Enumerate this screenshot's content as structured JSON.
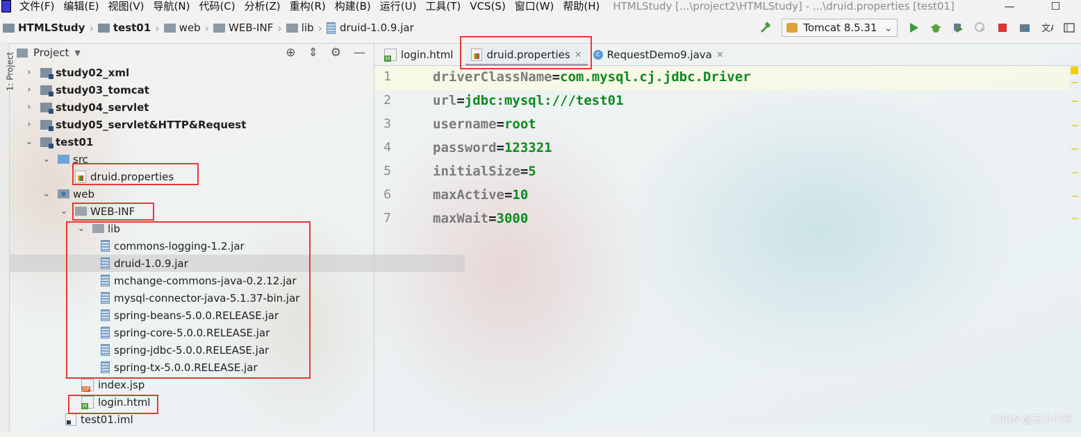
{
  "menu": {
    "items": [
      "文件(F)",
      "编辑(E)",
      "视图(V)",
      "导航(N)",
      "代码(C)",
      "分析(Z)",
      "重构(R)",
      "构建(B)",
      "运行(U)",
      "工具(T)",
      "VCS(S)",
      "窗口(W)",
      "帮助(H)"
    ],
    "window_title": "HTMLStudy [...\\project2\\HTMLStudy] - ...\\druid.properties [test01]",
    "minimize": "—",
    "maximize": "☐"
  },
  "breadcrumb": [
    "HTMLStudy",
    "test01",
    "web",
    "WEB-INF",
    "lib",
    "druid-1.0.9.jar"
  ],
  "run_config": "Tomcat 8.5.31",
  "tool_stripe_label": "1: Project",
  "project_panel": {
    "title": "Project",
    "tree": [
      {
        "label": "study02_xml",
        "bold": true
      },
      {
        "label": "study03_tomcat",
        "bold": true
      },
      {
        "label": "study04_servlet",
        "bold": true
      },
      {
        "label": "study05_servlet&HTTP&Request",
        "bold": true
      },
      {
        "label": "test01",
        "bold": true
      },
      {
        "label": "src"
      },
      {
        "label": "druid.properties"
      },
      {
        "label": "web"
      },
      {
        "label": "WEB-INF"
      },
      {
        "label": "lib"
      },
      {
        "label": "commons-logging-1.2.jar"
      },
      {
        "label": "druid-1.0.9.jar"
      },
      {
        "label": "mchange-commons-java-0.2.12.jar"
      },
      {
        "label": "mysql-connector-java-5.1.37-bin.jar"
      },
      {
        "label": "spring-beans-5.0.0.RELEASE.jar"
      },
      {
        "label": "spring-core-5.0.0.RELEASE.jar"
      },
      {
        "label": "spring-jdbc-5.0.0.RELEASE.jar"
      },
      {
        "label": "spring-tx-5.0.0.RELEASE.jar"
      },
      {
        "label": "index.jsp"
      },
      {
        "label": "login.html"
      },
      {
        "label": "test01.iml"
      }
    ]
  },
  "editor": {
    "tabs": [
      {
        "label": "login.html"
      },
      {
        "label": "druid.properties"
      },
      {
        "label": "RequestDemo9.java"
      }
    ],
    "lines": [
      {
        "n": "1",
        "key": "driverClassName",
        "eq": "=",
        "val": "com.mysql.cj.jdbc.Driver"
      },
      {
        "n": "2",
        "key": "url",
        "eq": "=",
        "val": "jdbc:mysql:///test01"
      },
      {
        "n": "3",
        "key": "username",
        "eq": "=",
        "val": "root"
      },
      {
        "n": "4",
        "key": "password",
        "eq": "=",
        "val": "123321"
      },
      {
        "n": "5",
        "key": "initialSize",
        "eq": "=",
        "val": "5"
      },
      {
        "n": "6",
        "key": "maxActive",
        "eq": "=",
        "val": "10"
      },
      {
        "n": "7",
        "key": "maxWait",
        "eq": "=",
        "val": "3000"
      }
    ]
  },
  "watermark": "CSDN @王小小鸭",
  "colors": {
    "highlight_box": "#e53935",
    "value_green": "#0a8a1f",
    "key_gray": "#7a7a7a"
  }
}
